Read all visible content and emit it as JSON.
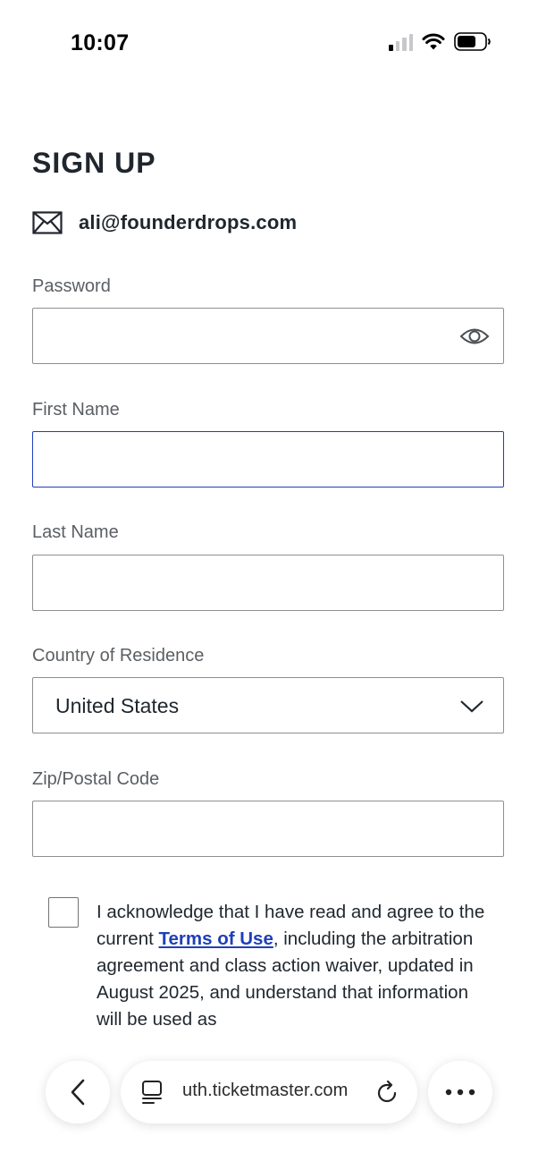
{
  "status_bar": {
    "time": "10:07"
  },
  "form": {
    "title": "SIGN UP",
    "email": "ali@founderdrops.com",
    "password": {
      "label": "Password",
      "value": ""
    },
    "first_name": {
      "label": "First Name",
      "value": ""
    },
    "last_name": {
      "label": "Last Name",
      "value": ""
    },
    "country": {
      "label": "Country of Residence",
      "value": "United States"
    },
    "zip": {
      "label": "Zip/Postal Code",
      "value": ""
    }
  },
  "legal": {
    "before_link": "I acknowledge that I have read and agree to the current ",
    "link": "Terms of Use",
    "after_link": ", including the arbitration agreement and class action waiver, updated in August 2025, and understand that information will be used as"
  },
  "browser": {
    "url": "uth.ticketmaster.com"
  },
  "colors": {
    "focus_border": "#1f3fb8",
    "link": "#1f3fb8",
    "text": "#1f262d",
    "label": "#5b5f63"
  }
}
